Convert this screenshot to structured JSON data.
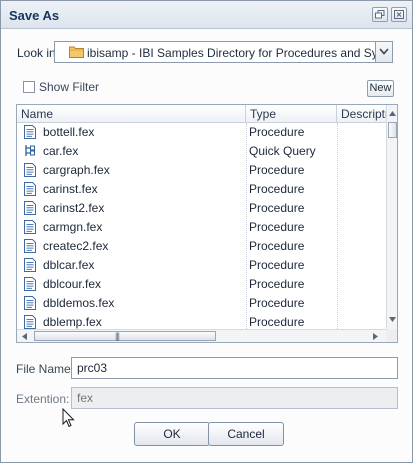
{
  "window": {
    "title": "Save As"
  },
  "look_in": {
    "label": "Look in",
    "value": "ibisamp - IBI Samples Directory for Procedures and Syno..."
  },
  "show_filter": {
    "label": "Show Filter",
    "checked": false
  },
  "new_button": {
    "label": "New"
  },
  "file_list": {
    "columns": [
      "Name",
      "Type",
      "Descripti"
    ],
    "rows": [
      {
        "name": "bottell.fex",
        "type": "Procedure",
        "icon": "procedure-file-icon"
      },
      {
        "name": "car.fex",
        "type": "Quick Query",
        "icon": "quick-query-icon"
      },
      {
        "name": "cargraph.fex",
        "type": "Procedure",
        "icon": "procedure-file-icon"
      },
      {
        "name": "carinst.fex",
        "type": "Procedure",
        "icon": "procedure-file-icon"
      },
      {
        "name": "carinst2.fex",
        "type": "Procedure",
        "icon": "procedure-file-icon"
      },
      {
        "name": "carmgn.fex",
        "type": "Procedure",
        "icon": "procedure-file-icon"
      },
      {
        "name": "createc2.fex",
        "type": "Procedure",
        "icon": "procedure-file-icon"
      },
      {
        "name": "dblcar.fex",
        "type": "Procedure",
        "icon": "procedure-file-icon"
      },
      {
        "name": "dblcour.fex",
        "type": "Procedure",
        "icon": "procedure-file-icon"
      },
      {
        "name": "dbldemos.fex",
        "type": "Procedure",
        "icon": "procedure-file-icon"
      },
      {
        "name": "dblemp.fex",
        "type": "Procedure",
        "icon": "procedure-file-icon"
      }
    ]
  },
  "file_name": {
    "label": "File Name:",
    "value": "prc03"
  },
  "extension": {
    "label": "Extention:",
    "placeholder": "fex"
  },
  "buttons": {
    "ok": "OK",
    "cancel": "Cancel"
  },
  "colors": {
    "title": "#15365c",
    "border": "#8e9bab",
    "folder": "#e8a93a"
  }
}
